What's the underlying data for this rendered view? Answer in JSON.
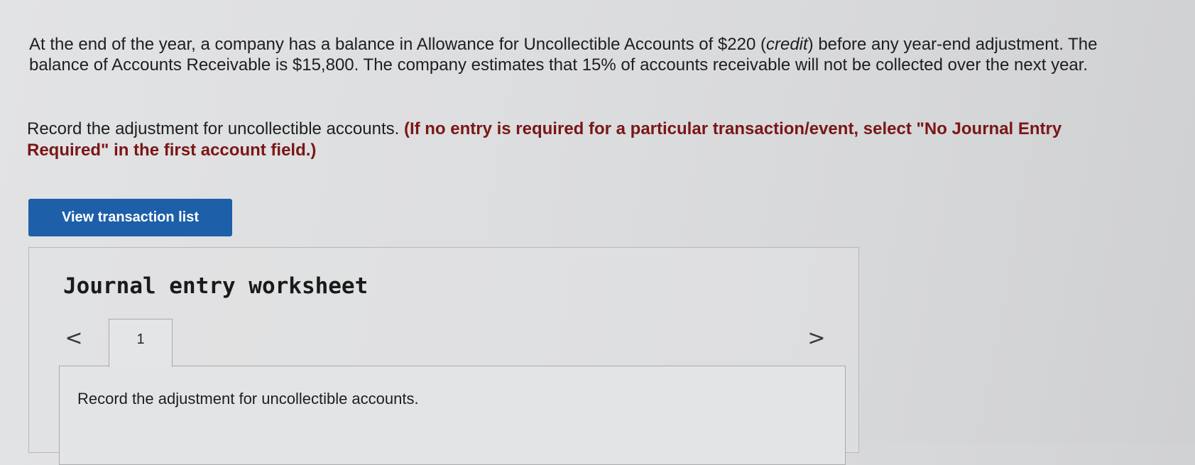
{
  "problem": {
    "part1": "At the end of the year, a company has a balance in Allowance for Uncollectible Accounts of $220 (",
    "italic": "credit",
    "part2": ") before any year-end adjustment. The balance of Accounts Receivable is $15,800. The company estimates that 15% of accounts receivable will not be collected over the next year."
  },
  "instruction": {
    "main": "Record the adjustment for uncollectible accounts. ",
    "note": "(If no entry is required for a particular transaction/event, select \"No Journal Entry Required\" in the first account field.)"
  },
  "buttons": {
    "view_transactions": "View transaction list"
  },
  "worksheet": {
    "title": "Journal entry worksheet",
    "prev": "<",
    "next": ">",
    "tabs": [
      "1"
    ],
    "entry_instruction": "Record the adjustment for uncollectible accounts."
  }
}
